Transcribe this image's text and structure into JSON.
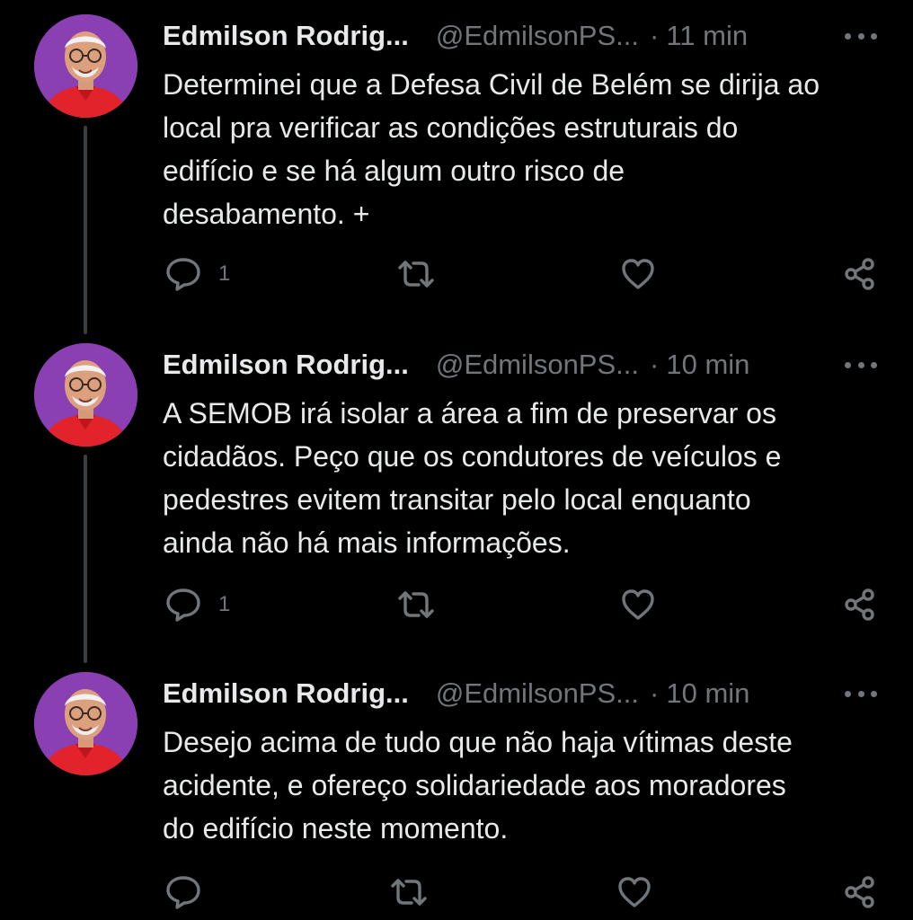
{
  "colors": {
    "background": "#000000",
    "text": "#e7e9ea",
    "muted": "#71767b",
    "thread_line": "#3a3f44",
    "avatar_bg": "#8a3fb3"
  },
  "tweets": [
    {
      "author_name": "Edmilson Rodrig...",
      "handle": "@EdmilsonPS...",
      "separator": "·",
      "time": "11 min",
      "text": "Determinei que a Defesa Civil de Belém se dirija ao\nlocal pra verificar as condições estruturais do\nedifício e se há algum outro risco de\ndesabamento. +",
      "reply_count": "1",
      "icons": [
        "reply-icon",
        "retweet-icon",
        "like-icon",
        "share-icon",
        "more-icon"
      ]
    },
    {
      "author_name": "Edmilson Rodrig...",
      "handle": "@EdmilsonPS...",
      "separator": "·",
      "time": "10 min",
      "text": "A SEMOB irá isolar a área a fim de preservar os\ncidadãos. Peço que os condutores de veículos e\npedestres evitem transitar pelo local enquanto\nainda não há mais informações.",
      "reply_count": "1",
      "icons": [
        "reply-icon",
        "retweet-icon",
        "like-icon",
        "share-icon",
        "more-icon"
      ]
    },
    {
      "author_name": "Edmilson Rodrig...",
      "handle": "@EdmilsonPS...",
      "separator": "·",
      "time": "10 min",
      "text": "Desejo acima de tudo que não haja vítimas deste\nacidente, e ofereço solidariedade aos moradores\ndo edifício neste momento.",
      "reply_count": "",
      "icons": [
        "reply-icon",
        "retweet-icon",
        "like-icon",
        "share-icon",
        "more-icon"
      ]
    }
  ]
}
